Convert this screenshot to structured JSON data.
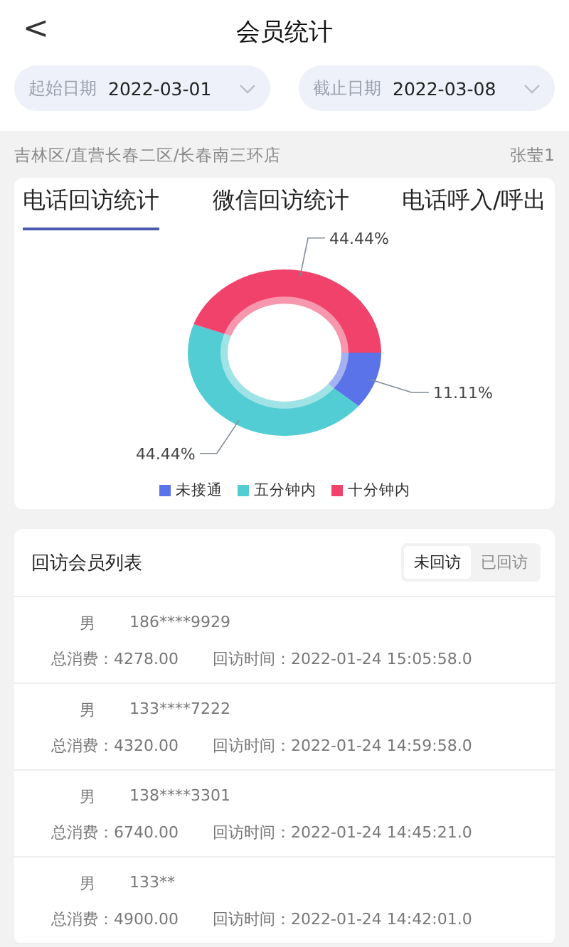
{
  "header": {
    "back": "<",
    "title": "会员统计"
  },
  "dates": [
    {
      "label": "起始日期",
      "value": "2022-03-01"
    },
    {
      "label": "截止日期",
      "value": "2022-03-08"
    }
  ],
  "store": {
    "path": "吉林区/直营长春二区/长春南三环店",
    "user": "张莹1"
  },
  "tabs": [
    {
      "label": "电话回访统计",
      "selected": true
    },
    {
      "label": "微信回访统计",
      "selected": false
    },
    {
      "label": "电话呼入/呼出",
      "selected": false
    }
  ],
  "chart_data": {
    "type": "donut",
    "categories": [
      "未接通",
      "五分钟内",
      "十分钟内"
    ],
    "values": [
      11.11,
      44.44,
      44.44
    ],
    "colors": [
      "#5b73e8",
      "#52cdd3",
      "#f0426b"
    ],
    "value_labels": [
      "11.11%",
      "44.44%",
      "44.44%"
    ]
  },
  "list": {
    "title": "回访会员列表",
    "filters": [
      {
        "label": "未回访",
        "selected": true
      },
      {
        "label": "已回访",
        "selected": false
      }
    ],
    "rows": [
      {
        "gender": "男",
        "phone": "186****9929",
        "spend_label": "总消费：",
        "spend": "4278.00",
        "time_label": "回访时间：",
        "time": "2022-01-24 15:05:58.0"
      },
      {
        "gender": "男",
        "phone": "133****7222",
        "spend_label": "总消费：",
        "spend": "4320.00",
        "time_label": "回访时间：",
        "time": "2022-01-24 14:59:58.0"
      },
      {
        "gender": "男",
        "phone": "138****3301",
        "spend_label": "总消费：",
        "spend": "6740.00",
        "time_label": "回访时间：",
        "time": "2022-01-24 14:45:21.0"
      },
      {
        "gender": "男",
        "phone": "133**",
        "spend_label": "总消费：",
        "spend": "4900.00",
        "time_label": "回访时间：",
        "time": "2022-01-24 14:42:01.0"
      }
    ]
  }
}
